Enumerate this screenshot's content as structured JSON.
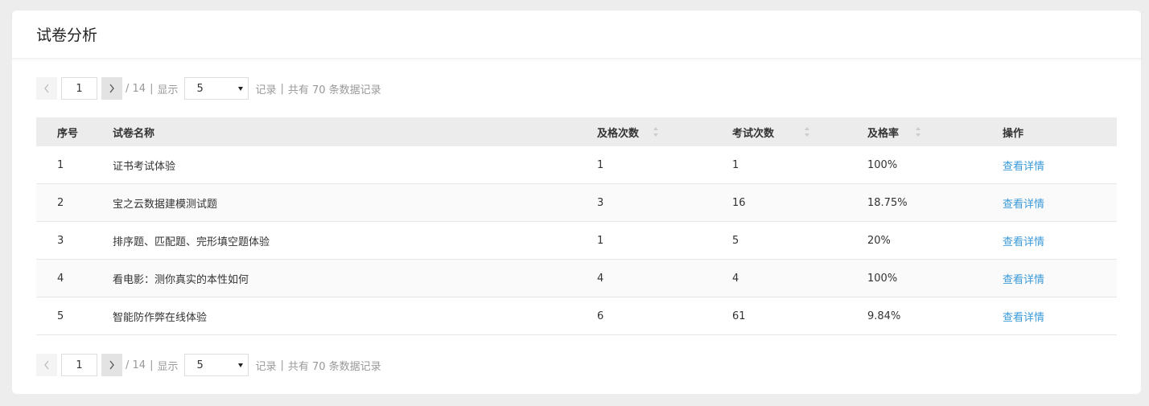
{
  "page": {
    "title": "试卷分析"
  },
  "pager": {
    "current_page": "1",
    "total_pages": "/ 14",
    "sep1": "|",
    "show_label": "显示",
    "page_size": "5",
    "records_label": "记录",
    "sep2": "|",
    "total_records": "共有 70 条数据记录"
  },
  "table": {
    "headers": {
      "idx": "序号",
      "name": "试卷名称",
      "pass_count": "及格次数",
      "exam_count": "考试次数",
      "pass_rate": "及格率",
      "operation": "操作"
    },
    "rows": [
      {
        "idx": "1",
        "name": "证书考试体验",
        "pass_count": "1",
        "exam_count": "1",
        "pass_rate": "100%",
        "action": "查看详情"
      },
      {
        "idx": "2",
        "name": "宝之云数据建模测试题",
        "pass_count": "3",
        "exam_count": "16",
        "pass_rate": "18.75%",
        "action": "查看详情"
      },
      {
        "idx": "3",
        "name": "排序题、匹配题、完形填空题体验",
        "pass_count": "1",
        "exam_count": "5",
        "pass_rate": "20%",
        "action": "查看详情"
      },
      {
        "idx": "4",
        "name": "看电影：测你真实的本性如何",
        "pass_count": "4",
        "exam_count": "4",
        "pass_rate": "100%",
        "action": "查看详情"
      },
      {
        "idx": "5",
        "name": "智能防作弊在线体验",
        "pass_count": "6",
        "exam_count": "61",
        "pass_rate": "9.84%",
        "action": "查看详情"
      }
    ]
  },
  "colors": {
    "link": "#3a9ad9",
    "header_bg": "#ececec",
    "page_bg": "#ededed"
  },
  "icons": {
    "prev": "chevron-left-icon",
    "next": "chevron-right-icon",
    "sort": "sort-icon",
    "dropdown": "caret-down-icon"
  }
}
